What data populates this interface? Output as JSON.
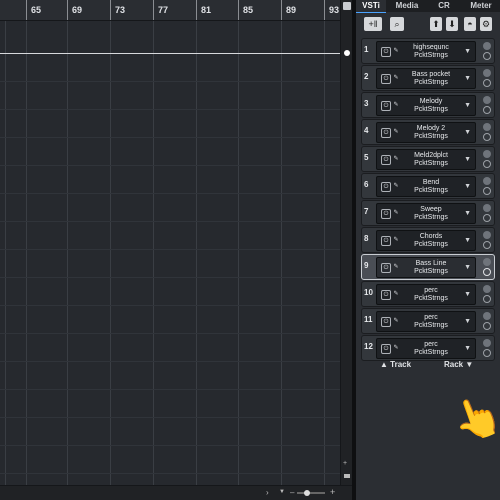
{
  "ruler": {
    "ticks": [
      "65",
      "69",
      "73",
      "77",
      "81",
      "85",
      "89",
      "93"
    ]
  },
  "rack": {
    "tabs": [
      "VSTi",
      "Media",
      "CR",
      "Meter"
    ],
    "active_tab": "VSTi",
    "slots": [
      {
        "num": "1",
        "line1": "highsequnc",
        "line2": "PcktStrngs"
      },
      {
        "num": "2",
        "line1": "Bass pocket",
        "line2": "PcktStrngs"
      },
      {
        "num": "3",
        "line1": "Melody",
        "line2": "PcktStrngs"
      },
      {
        "num": "4",
        "line1": "Melody 2",
        "line2": "PcktStrngs"
      },
      {
        "num": "5",
        "line1": "Meld2dplct",
        "line2": "PcktStrngs"
      },
      {
        "num": "6",
        "line1": "Bend",
        "line2": "PcktStrngs"
      },
      {
        "num": "7",
        "line1": "Sweep",
        "line2": "PcktStrngs"
      },
      {
        "num": "8",
        "line1": "Chords",
        "line2": "PcktStrngs"
      },
      {
        "num": "9",
        "line1": "Bass Line",
        "line2": "PcktStrngs"
      },
      {
        "num": "10",
        "line1": "perc",
        "line2": "PcktStrngs"
      },
      {
        "num": "11",
        "line1": "perc",
        "line2": "PcktStrngs"
      },
      {
        "num": "12",
        "line1": "perc",
        "line2": "PcktStrngs"
      }
    ],
    "selected_slot": "9",
    "footer": {
      "track": "▲ Track",
      "rack": "Rack ▼"
    }
  },
  "colors": {
    "accent": "#4aa3ff",
    "background": "#26292e"
  },
  "icons": [
    "add-instrument-icon",
    "search-icon",
    "move-up-icon",
    "move-down-icon",
    "eye-icon",
    "gear-icon",
    "power-icon",
    "edit-icon",
    "dropdown-icon",
    "pointing-hand-icon"
  ]
}
